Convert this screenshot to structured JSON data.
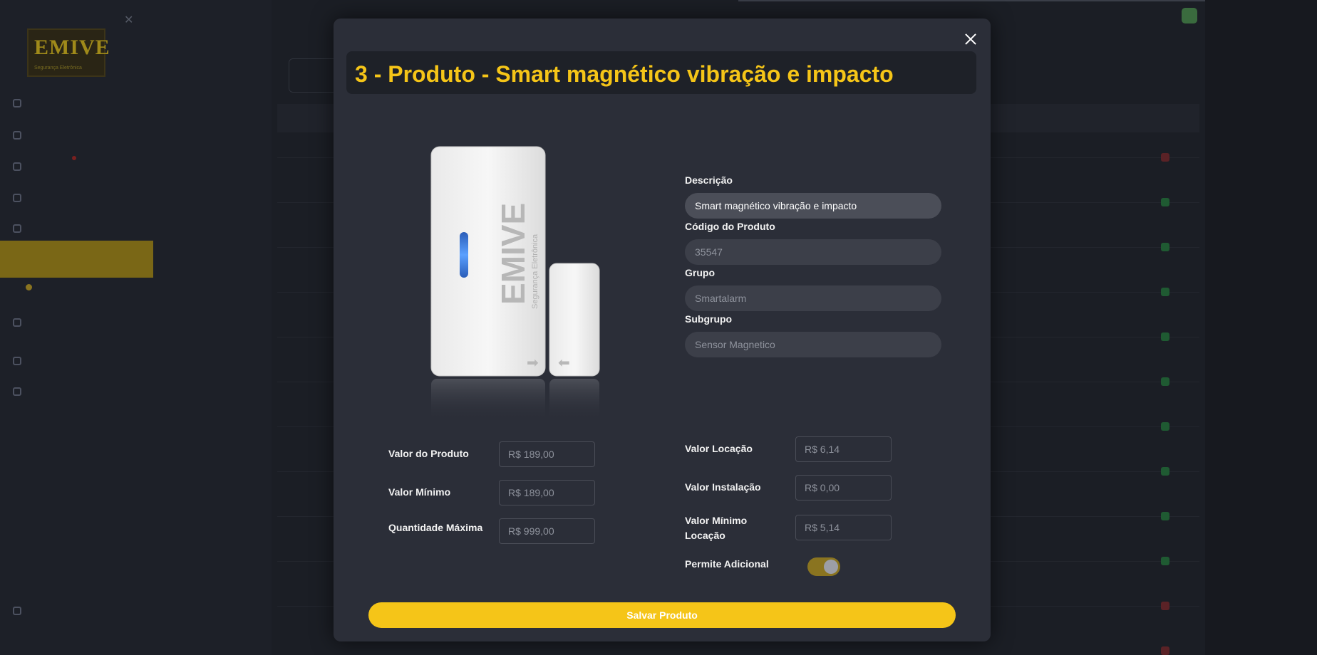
{
  "modal": {
    "title": "3 - Produto - Smart magnético vibração e impacto",
    "close_icon": "close-icon",
    "image_icon": "magnetic-sensor-image",
    "image_brand": "EMIVE",
    "image_subbrand": "Segurança Eletrônica",
    "descricao_label": "Descrição",
    "descricao_value": "Smart magnético vibração e impacto",
    "codigo_label": "Código do Produto",
    "codigo_value": "35547",
    "grupo_label": "Grupo",
    "grupo_value": "Smartalarm",
    "subgrupo_label": "Subgrupo",
    "subgrupo_value": "Sensor Magnetico",
    "valor_produto_label": "Valor do Produto",
    "valor_produto_value": "R$ 189,00",
    "valor_minimo_label": "Valor Mínimo",
    "valor_minimo_value": "R$ 189,00",
    "quantidade_maxima_label": "Quantidade Máxima",
    "quantidade_maxima_value": "R$ 999,00",
    "valor_locacao_label": "Valor Locação",
    "valor_locacao_value": "R$ 6,14",
    "valor_instalacao_label": "Valor Instalação",
    "valor_instalacao_value": "R$ 0,00",
    "valor_minimo_locacao_label_1": "Valor Mínimo",
    "valor_minimo_locacao_label_2": "Locação",
    "valor_minimo_locacao_value": "R$ 5,14",
    "permite_adicional_label": "Permite Adicional",
    "permite_adicional_on": true,
    "save_label": "Salvar Produto"
  },
  "colors": {
    "accent": "#f5c518",
    "modal_bg": "#2b2e38",
    "title_bg": "#1e2128"
  }
}
